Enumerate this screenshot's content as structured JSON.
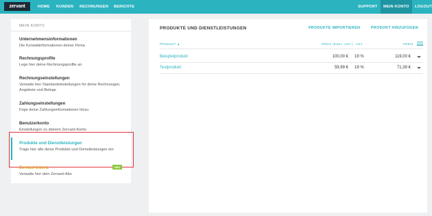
{
  "topbar": {
    "logo": "zervant",
    "nav": [
      "HOME",
      "KUNDEN",
      "RECHNUNGEN",
      "BERICHTE"
    ],
    "right": [
      "SUPPORT",
      "MEIN KONTO",
      "LOGOUT"
    ]
  },
  "sidebar": {
    "heading": "MEIN KONTO",
    "items": [
      {
        "title": "Unternehmensinformationen",
        "desc": "Die Kontaktinformationen deiner Firma"
      },
      {
        "title": "Rechnungsprofile",
        "desc": "Lege hier deine Rechnungsprofile an"
      },
      {
        "title": "Rechnungseinstellungen",
        "desc": "Verwalte hier Standardeinstellungen für deine Rechnungen, Angebote und Belege"
      },
      {
        "title": "Zahlungseinstellungen",
        "desc": "Füge deine Zahlungsinformationen hinzu"
      },
      {
        "title": "Benutzerkonto",
        "desc": "Einstellungen zu deinem Zervant-Konto"
      },
      {
        "title": "Produkte und Dienstleistungen",
        "desc": "Trage hier alle deine Produkte und Dienstleistungen ein"
      },
      {
        "title": "Zervant-Lizenz",
        "desc": "Verwalte hier dein Zervant-Abo",
        "badge": "NEU"
      }
    ]
  },
  "panel": {
    "title": "PRODUKTE UND DIENSTLEISTUNGEN",
    "import_label": "PRODUKTE IMPORTIEREN",
    "add_label": "PRODUKT HINZUFÜGEN",
    "columns": {
      "product": "PRODUKT ▲",
      "price_excl": "PREIS (EXKL. UST.)",
      "vat": "UST",
      "price": "PREIS"
    },
    "rows": [
      {
        "name": "Beispielprodukt",
        "price_excl": "100,00 €",
        "vat": "19 %",
        "price": "119,00 €"
      },
      {
        "name": "Testprodukt",
        "price_excl": "59,99 €",
        "vat": "19 %",
        "price": "71,39 €"
      }
    ]
  }
}
